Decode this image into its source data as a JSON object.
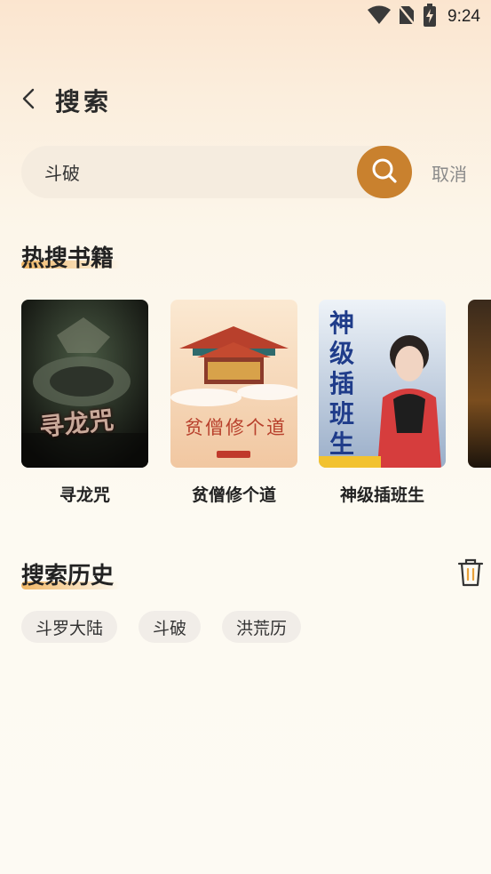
{
  "status": {
    "time": "9:24"
  },
  "header": {
    "title": "搜索"
  },
  "search": {
    "query": "斗破",
    "cancel_label": "取消"
  },
  "hot_books": {
    "title": "热搜书籍",
    "items": [
      {
        "title": "寻龙咒",
        "cover_text": "寻龙咒",
        "cover_colors": [
          "#2c3b2e",
          "#0d0d0b"
        ]
      },
      {
        "title": "贫僧修个道",
        "cover_text": "贫僧修个道",
        "cover_colors": [
          "#f6e2c4",
          "#e9b98c"
        ]
      },
      {
        "title": "神级插班生",
        "cover_text": "神级插班生",
        "cover_colors": [
          "#dfe8f3",
          "#7a8fb5"
        ]
      }
    ]
  },
  "history": {
    "title": "搜索历史",
    "items": [
      "斗罗大陆",
      "斗破",
      "洪荒历"
    ]
  },
  "colors": {
    "accent": "#c9812e",
    "chip_bg": "#f1ede8"
  }
}
